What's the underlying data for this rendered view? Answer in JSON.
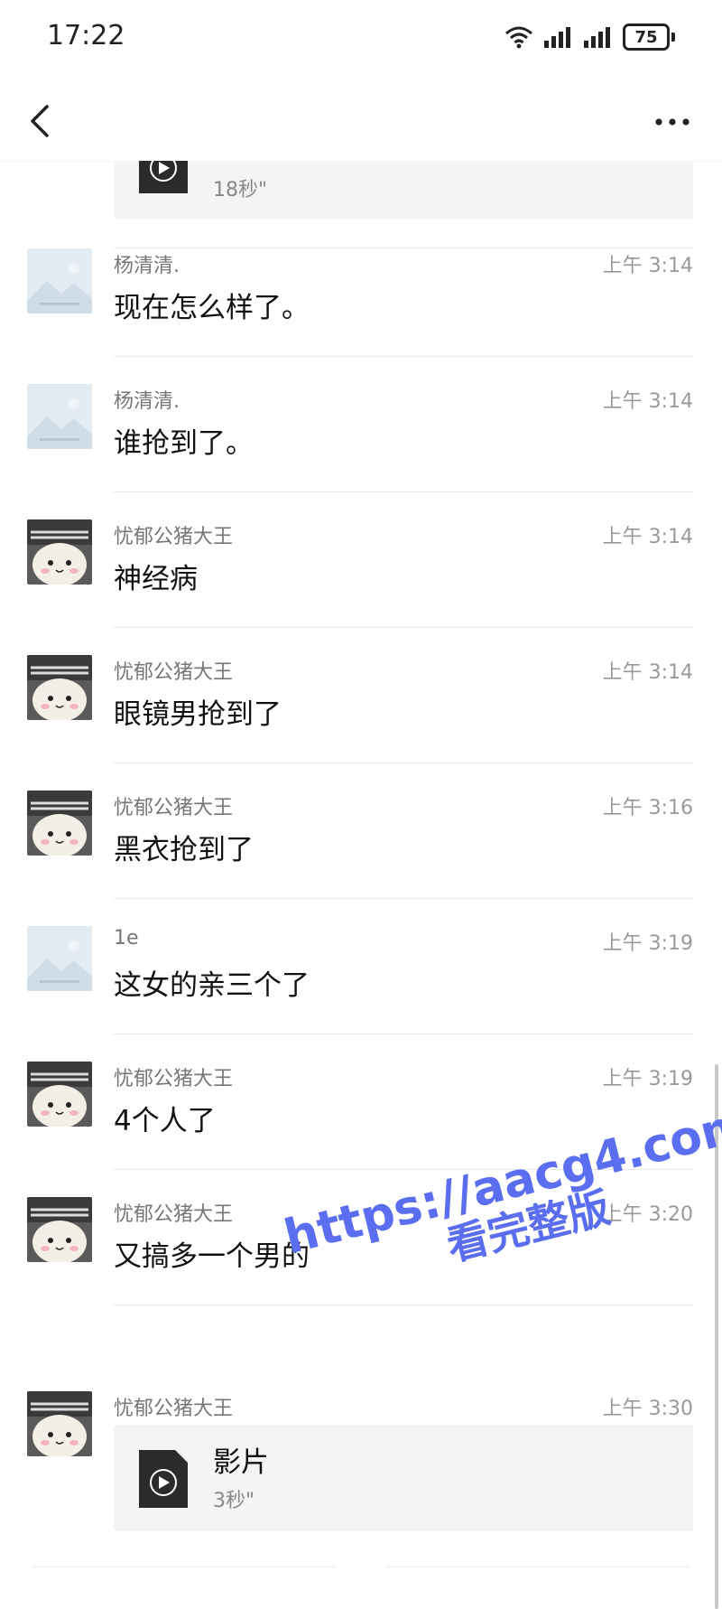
{
  "status_bar": {
    "time": "17:22",
    "battery": "75"
  },
  "top_item": {
    "duration": "18秒\""
  },
  "messages": [
    {
      "sender": "杨清清.",
      "time": "上午 3:14",
      "text": "现在怎么样了。",
      "avatar": "landscape"
    },
    {
      "sender": "杨清清.",
      "time": "上午 3:14",
      "text": "谁抢到了。",
      "avatar": "landscape"
    },
    {
      "sender": "忧郁公猪大王",
      "time": "上午 3:14",
      "text": "神经病",
      "avatar": "plush"
    },
    {
      "sender": "忧郁公猪大王",
      "time": "上午 3:14",
      "text": "眼镜男抢到了",
      "avatar": "plush"
    },
    {
      "sender": "忧郁公猪大王",
      "time": "上午 3:16",
      "text": "黑衣抢到了",
      "avatar": "plush"
    },
    {
      "sender": "1e",
      "time": "上午 3:19",
      "text": "这女的亲三个了",
      "avatar": "landscape"
    },
    {
      "sender": "忧郁公猪大王",
      "time": "上午 3:19",
      "text": "4个人了",
      "avatar": "plush"
    },
    {
      "sender": "忧郁公猪大王",
      "time": "上午 3:20",
      "text": "又搞多一个男的",
      "avatar": "plush"
    }
  ],
  "last_message": {
    "sender": "忧郁公猪大王",
    "time": "上午 3:30",
    "video_title": "影片",
    "duration": "3秒\""
  },
  "watermark": {
    "line1": "https://aacg4.com",
    "line2": "看完整版"
  },
  "icons": [
    "wifi-icon",
    "signal-icon",
    "battery-icon",
    "back-icon",
    "more-icon",
    "video-file-icon"
  ],
  "colors": {
    "watermark": "#5b6ef0",
    "card_bg": "#f4f4f4",
    "meta_text": "#999999"
  }
}
